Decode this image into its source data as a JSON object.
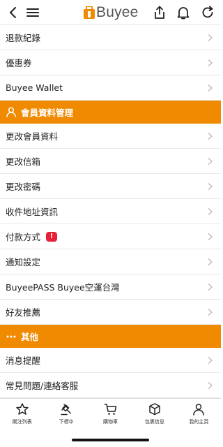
{
  "header": {
    "back_icon": "chevron-left-icon",
    "menu_icon": "hamburger-icon",
    "logo_text": "Buyee",
    "share_icon": "share-icon",
    "bell_icon": "bell-icon",
    "refresh_icon": "refresh-icon",
    "brand_color": "#f08a00"
  },
  "menu": {
    "rows_top": [
      {
        "label": "退款紀錄"
      },
      {
        "label": "優惠券"
      },
      {
        "label": "Buyee Wallet"
      }
    ],
    "section_member": {
      "label": "會員資料管理",
      "icon": "user-icon"
    },
    "rows_member": [
      {
        "label": "更改會員資料"
      },
      {
        "label": "更改信箱"
      },
      {
        "label": "更改密碼"
      },
      {
        "label": "收件地址資訊"
      },
      {
        "label": "付款方式",
        "badge": "!"
      },
      {
        "label": "通知設定"
      },
      {
        "label": "BuyeePASS Buyee空運台灣"
      },
      {
        "label": "好友推薦"
      }
    ],
    "section_other": {
      "label": "其他",
      "icon": "more-dots-icon"
    },
    "rows_other": [
      {
        "label": "消息提醒"
      },
      {
        "label": "常見問題/連絡客服"
      }
    ]
  },
  "tabbar": {
    "tabs": [
      {
        "label": "關注列表",
        "icon": "star-icon"
      },
      {
        "label": "下標中",
        "icon": "gavel-icon"
      },
      {
        "label": "購物車",
        "icon": "cart-icon"
      },
      {
        "label": "包裹信息",
        "icon": "package-icon"
      },
      {
        "label": "我的主頁",
        "icon": "profile-icon"
      }
    ]
  }
}
